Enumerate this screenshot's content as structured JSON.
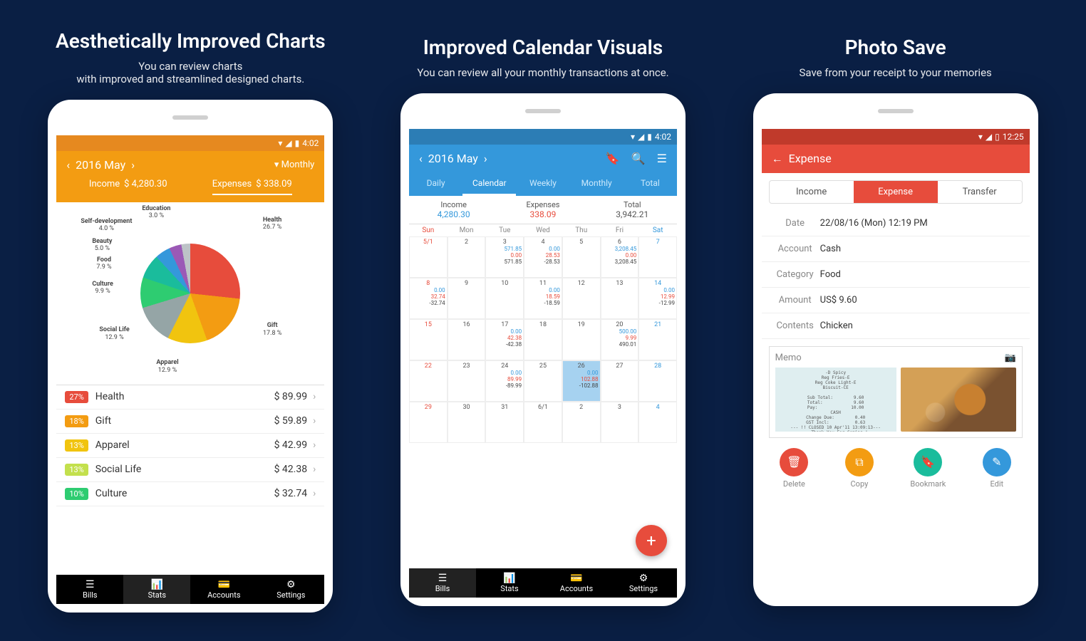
{
  "panels": [
    {
      "title": "Aesthetically Improved Charts",
      "subtitle": "You can review charts\nwith improved and streamlined designed charts."
    },
    {
      "title": "Improved Calendar Visuals",
      "subtitle": "You can review all your monthly transactions at once."
    },
    {
      "title": "Photo Save",
      "subtitle": "Save from your receipt to your memories"
    }
  ],
  "status_time1": "4:02",
  "status_time2": "4:02",
  "status_time3": "12:25",
  "screen1": {
    "month": "2016 May",
    "filter": "Monthly",
    "income_label": "Income",
    "income_value": "$ 4,280.30",
    "expense_label": "Expenses",
    "expense_value": "$ 338.09",
    "categories": [
      {
        "pct": "27%",
        "name": "Health",
        "amount": "$ 89.99",
        "color": "#e74c3c"
      },
      {
        "pct": "18%",
        "name": "Gift",
        "amount": "$ 59.89",
        "color": "#f39c12"
      },
      {
        "pct": "13%",
        "name": "Apparel",
        "amount": "$ 42.99",
        "color": "#f1c40f"
      },
      {
        "pct": "13%",
        "name": "Social Life",
        "amount": "$ 42.38",
        "color": "#c3e04d"
      },
      {
        "pct": "10%",
        "name": "Culture",
        "amount": "$ 32.74",
        "color": "#2ecc71"
      }
    ]
  },
  "chart_data": {
    "type": "pie",
    "title": "",
    "categories": [
      "Health",
      "Gift",
      "Apparel",
      "Social Life",
      "Culture",
      "Food",
      "Beauty",
      "Self-development",
      "Education"
    ],
    "values": [
      26.7,
      17.8,
      12.9,
      12.9,
      9.9,
      7.9,
      5.0,
      4.0,
      3.0
    ],
    "unit": "%"
  },
  "screen2": {
    "month": "2016 May",
    "tabs": [
      "Daily",
      "Calendar",
      "Weekly",
      "Monthly",
      "Total"
    ],
    "active_tab": "Calendar",
    "summary": {
      "income_label": "Income",
      "income": "4,280.30",
      "expense_label": "Expenses",
      "expense": "338.09",
      "total_label": "Total",
      "total": "3,942.21"
    },
    "dow": [
      "Sun",
      "Mon",
      "Tue",
      "Wed",
      "Thu",
      "Fri",
      "Sat"
    ],
    "cells": [
      {
        "d": "5/1",
        "sun": true
      },
      {
        "d": "2"
      },
      {
        "d": "3",
        "inc": "571.85",
        "exp": "0.00",
        "tot": "571.85"
      },
      {
        "d": "4",
        "inc": "0.00",
        "exp": "28.53",
        "tot": "-28.53"
      },
      {
        "d": "5"
      },
      {
        "d": "6",
        "inc": "3,208.45",
        "exp": "0.00",
        "tot": "3,208.45"
      },
      {
        "d": "7",
        "sat": true
      },
      {
        "d": "8",
        "sun": true,
        "inc": "0.00",
        "exp": "32.74",
        "tot": "-32.74"
      },
      {
        "d": "9"
      },
      {
        "d": "10"
      },
      {
        "d": "11",
        "inc": "0.00",
        "exp": "18.59",
        "tot": "-18.59"
      },
      {
        "d": "12"
      },
      {
        "d": "13"
      },
      {
        "d": "14",
        "sat": true,
        "inc": "0.00",
        "exp": "12.99",
        "tot": "-12.99"
      },
      {
        "d": "15",
        "sun": true
      },
      {
        "d": "16"
      },
      {
        "d": "17",
        "inc": "0.00",
        "exp": "42.38",
        "tot": "-42.38"
      },
      {
        "d": "18"
      },
      {
        "d": "19"
      },
      {
        "d": "20",
        "inc": "500.00",
        "exp": "9.99",
        "tot": "490.01"
      },
      {
        "d": "21",
        "sat": true
      },
      {
        "d": "22",
        "sun": true
      },
      {
        "d": "23"
      },
      {
        "d": "24",
        "inc": "0.00",
        "exp": "89.99",
        "tot": "-89.99"
      },
      {
        "d": "25"
      },
      {
        "d": "26",
        "today": true,
        "inc": "0.00",
        "exp": "102.88",
        "tot": "-102.88"
      },
      {
        "d": "27"
      },
      {
        "d": "28",
        "sat": true
      },
      {
        "d": "29",
        "sun": true
      },
      {
        "d": "30"
      },
      {
        "d": "31"
      },
      {
        "d": "6/1"
      },
      {
        "d": "2"
      },
      {
        "d": "3"
      },
      {
        "d": "4",
        "sat": true
      }
    ]
  },
  "bottom_nav": [
    "Bills",
    "Stats",
    "Accounts",
    "Settings"
  ],
  "screen3": {
    "title": "Expense",
    "type_tabs": [
      "Income",
      "Expense",
      "Transfer"
    ],
    "active_type": "Expense",
    "fields": [
      {
        "label": "Date",
        "value": "22/08/16 (Mon)   12:19 PM"
      },
      {
        "label": "Account",
        "value": "Cash"
      },
      {
        "label": "Category",
        "value": "Food"
      },
      {
        "label": "Amount",
        "value": "US$ 9.60"
      },
      {
        "label": "Contents",
        "value": "Chicken"
      }
    ],
    "memo_label": "Memo",
    "receipt_text": "-D Spicy\nReg Fries-E\nReg Coke Light-E\nBiscuit-CE\n\nSub Total:        9.60\nTotal:            9.60\nPay:             10.00\nCASH\nChange Due:        0.40\nGST Incl:          0.63\n--- !! CLOSED 10 Apr'11 13:09:13---\n   Thank You For Coming !\n\nComplete easy survey and receive a",
    "actions": [
      {
        "label": "Delete",
        "color": "#e74c3c",
        "icon": "🗑"
      },
      {
        "label": "Copy",
        "color": "#f39c12",
        "icon": "⧉"
      },
      {
        "label": "Bookmark",
        "color": "#1abc9c",
        "icon": "🔖"
      },
      {
        "label": "Edit",
        "color": "#3498db",
        "icon": "✎"
      }
    ]
  }
}
